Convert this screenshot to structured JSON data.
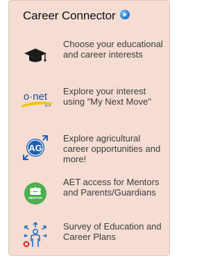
{
  "panel": {
    "title": "Career Connector",
    "items": [
      {
        "label": "Choose your educational and career interests",
        "icon": "graduation-cap-icon"
      },
      {
        "label": "Explore your interest using \"My Next Move\"",
        "icon": "onet-logo-icon",
        "logo_text": "o·net",
        "logo_sub": "in-it"
      },
      {
        "label": "Explore agricultural career opportunities and more!",
        "icon": "ag-badge-icon",
        "badge_text": "AG"
      },
      {
        "label": "AET access for Mentors and Parents/Guardians",
        "icon": "mentor-icon",
        "badge_text": "MENTOR"
      },
      {
        "label": "Survey of Education and Career Plans",
        "icon": "survey-people-icon"
      }
    ]
  },
  "colors": {
    "panel_bg": "#f5ddd3",
    "text": "#3c3c3c",
    "ag_blue": "#1f5fb4",
    "mentor_green": "#4caf50",
    "onet_blue": "#1d4f91",
    "onet_yellow": "#f2c500"
  }
}
